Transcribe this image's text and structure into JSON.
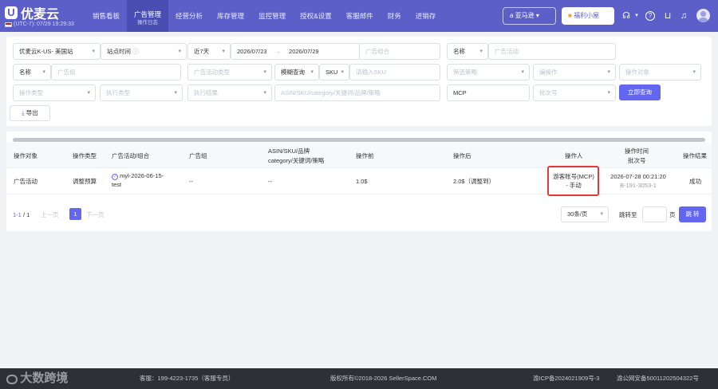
{
  "app": {
    "logo_text": "优麦云",
    "clock": "(UTC-7): 07/29 19:29:33"
  },
  "nav": {
    "items": [
      "销售看板",
      "广告管理",
      "经营分析",
      "库存管理",
      "监控管理",
      "授权&设置",
      "客服邮件",
      "财务",
      "进销存"
    ],
    "active_sub": "操作日志"
  },
  "header": {
    "region_label": "亚马逊",
    "welfare_label": "福利小屋"
  },
  "filters": {
    "store": "优麦云K-US- 美国站",
    "site_time": "站点时间",
    "date_range": "近7天",
    "date_start": "2026/07/23",
    "date_end": "2026/07/29",
    "ad_group_ph": "广告组合",
    "name_label": "名称",
    "ad_campaign_ph": "广告活动",
    "name_label2": "名称",
    "ad_group2_ph": "广告组",
    "ad_campaign_type_ph": "广告活动类型",
    "fuzzy_label": "模糊查询",
    "sku_label": "SKU",
    "sku_ph": "请输入SKU",
    "strategy_ph": "筛选策略",
    "operation_ph": "编操作",
    "operation_target_ph": "操作对象",
    "operation_type_ph": "操作类型",
    "exec_type_ph": "执行类型",
    "exec_result_ph": "执行结果",
    "keyword_ph": "ASIN/SKU/category/关键词/品牌/策略",
    "operator_value": "MCP",
    "batch_ph": "批次号",
    "query_button": "立即查询",
    "export_button": "导出"
  },
  "table": {
    "headers": {
      "target": "操作对象",
      "type": "操作类型",
      "campaign": "广告活动/组合",
      "group": "广告组",
      "asin_1": "ASIN/SKU/品牌",
      "asin_2": "category/关键词/策略",
      "before": "操作前",
      "after": "操作后",
      "operator": "操作人",
      "time_1": "操作时间",
      "time_2": "批次号",
      "result": "操作结果"
    },
    "rows": [
      {
        "target": "广告活动",
        "type": "调整预算",
        "campaign_1": "myl-2026-06-15-",
        "campaign_2": "test",
        "group": "--",
        "asin": "--",
        "before": "1.0$",
        "after": "2.0$（调整到）",
        "operator_1": "游客账号(MCP)",
        "operator_2": "- 手动",
        "time": "2026-07-28 00:21:20",
        "batch": "B-191-3053-1",
        "result": "成功"
      }
    ]
  },
  "pagination": {
    "range": "1-1",
    "separator": "/",
    "total": "1",
    "prev": "上一页",
    "page": "1",
    "next": "下一页",
    "page_size": "30条/页",
    "jump_label": "跳转至",
    "page_unit": "页",
    "jump_button": "跳 转"
  },
  "footer": {
    "brand": "大数跨境",
    "service": "客服：199-4223-1735（客服专员）",
    "copyright": "版权所有©2018-2026 SellerSpace.COM",
    "icp": "渝ICP备2024021909号-3",
    "police": "渝公网安备50011202504322号"
  },
  "colors": {
    "primary": "#5b5fc7",
    "accent": "#6366f1",
    "highlight_border": "#e03b3b"
  }
}
